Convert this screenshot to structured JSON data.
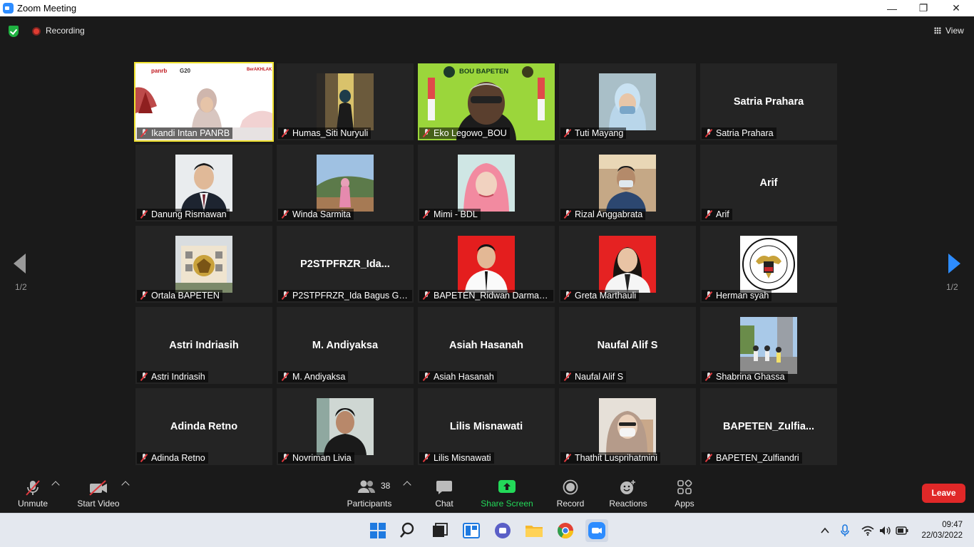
{
  "window": {
    "title": "Zoom Meeting"
  },
  "topbar": {
    "recording_label": "Recording",
    "view_label": "View"
  },
  "pager": {
    "left": "1/2",
    "right": "1/2"
  },
  "tiles": [
    {
      "label": "Ikandi Intan PANRB",
      "big": "",
      "kind": "video-panrb",
      "active": true
    },
    {
      "label": "Humas_Siti Nuryuli",
      "big": "",
      "kind": "photo-corridor"
    },
    {
      "label": "Eko Legowo_BOU",
      "big": "",
      "kind": "video-bou"
    },
    {
      "label": "Tuti Mayang",
      "big": "",
      "kind": "photo-mask"
    },
    {
      "label": "Satria Prahara",
      "big": "Satria Prahara",
      "kind": "name"
    },
    {
      "label": "Danung Rismawan",
      "big": "",
      "kind": "photo-suit"
    },
    {
      "label": "Winda Sarmita",
      "big": "",
      "kind": "photo-hill"
    },
    {
      "label": "Mimi - BDL",
      "big": "",
      "kind": "photo-hijab-pink"
    },
    {
      "label": "Rizal Anggabrata",
      "big": "",
      "kind": "photo-mask-man"
    },
    {
      "label": "Arif",
      "big": "Arif",
      "kind": "name"
    },
    {
      "label": "Ortala BAPETEN",
      "big": "",
      "kind": "photo-building"
    },
    {
      "label": "P2STPFRZR_Ida Bagus Ged...",
      "big": "P2STPFRZR_Ida...",
      "kind": "name"
    },
    {
      "label": "BAPETEN_Ridwan Darmawan",
      "big": "",
      "kind": "photo-red-man"
    },
    {
      "label": "Greta Marthauli",
      "big": "",
      "kind": "photo-red-woman"
    },
    {
      "label": "Herman syah",
      "big": "",
      "kind": "photo-emblem"
    },
    {
      "label": "Astri Indriasih",
      "big": "Astri Indriasih",
      "kind": "name"
    },
    {
      "label": "M. Andiyaksa",
      "big": "M. Andiyaksa",
      "kind": "name"
    },
    {
      "label": "Asiah Hasanah",
      "big": "Asiah Hasanah",
      "kind": "name"
    },
    {
      "label": "Naufal Alif S",
      "big": "Naufal Alif S",
      "kind": "name"
    },
    {
      "label": "Shabrina Ghassa",
      "big": "",
      "kind": "photo-street"
    },
    {
      "label": "Adinda Retno",
      "big": "Adinda Retno",
      "kind": "name"
    },
    {
      "label": "Novriman Livia",
      "big": "",
      "kind": "photo-young-man"
    },
    {
      "label": "Lilis Misnawati",
      "big": "Lilis Misnawati",
      "kind": "name"
    },
    {
      "label": "Thathit Lusprihatmini",
      "big": "",
      "kind": "photo-mask-hijab"
    },
    {
      "label": "BAPETEN_Zulfiandri",
      "big": "BAPETEN_Zulfia...",
      "kind": "name"
    }
  ],
  "panrb_video": {
    "logo1": "panrb",
    "logo2": "G20",
    "logo3": "BerAKHLAK"
  },
  "bou_video": {
    "logo_text": "BOU BAPETEN"
  },
  "toolbar": {
    "unmute": "Unmute",
    "start_video": "Start Video",
    "participants": "Participants",
    "participants_count": "38",
    "chat": "Chat",
    "share_screen": "Share Screen",
    "record": "Record",
    "reactions": "Reactions",
    "apps": "Apps",
    "leave": "Leave"
  },
  "clock": {
    "time": "09:47",
    "date": "22/03/2022"
  },
  "colors": {
    "accent": "#2d8cff",
    "share_green": "#23d959",
    "leave_red": "#e02828",
    "active_outline": "#f0e230"
  }
}
